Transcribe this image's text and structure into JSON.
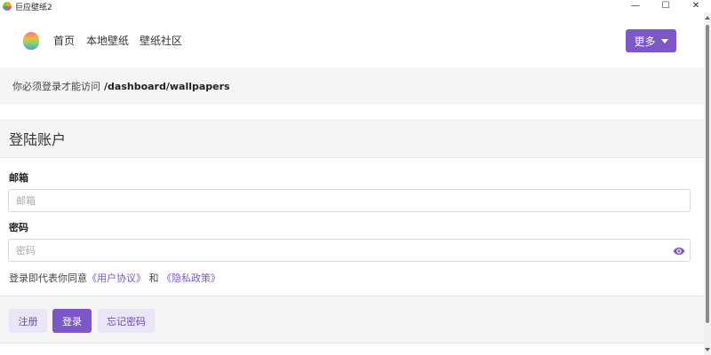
{
  "window": {
    "title": "巨应壁纸2",
    "minimize": "—",
    "maximize": "☐",
    "close": "✕"
  },
  "nav": {
    "links": [
      "首页",
      "本地壁纸",
      "壁纸社区"
    ],
    "more_label": "更多"
  },
  "notice": {
    "text": "你必须登录才能访问",
    "path": "/dashboard/wallpapers"
  },
  "login": {
    "title": "登陆账户",
    "email_label": "邮箱",
    "email_placeholder": "邮箱",
    "password_label": "密码",
    "password_placeholder": "密码",
    "agreement_prefix": "登录即代表你同意",
    "user_agreement": "《用户协议》",
    "and": "和",
    "privacy_policy": "《隐私政策》",
    "register_label": "注册",
    "login_label": "登录",
    "forgot_label": "忘记密码"
  },
  "colors": {
    "accent": "#7b57c8",
    "accent_light": "#ebe6f5"
  }
}
